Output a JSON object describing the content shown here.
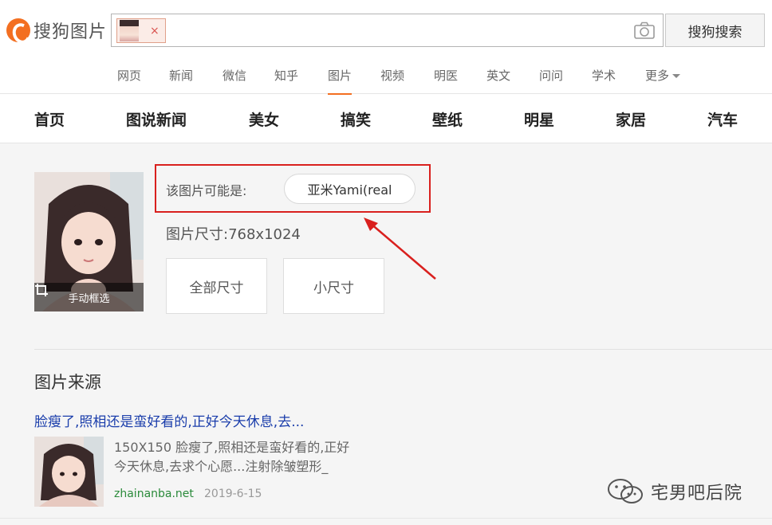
{
  "header": {
    "logo_text": "搜狗图片",
    "search_chip_close": "×",
    "search_button": "搜狗搜索"
  },
  "nav": {
    "tabs": [
      "网页",
      "新闻",
      "微信",
      "知乎",
      "图片",
      "视频",
      "明医",
      "英文",
      "问问",
      "学术",
      "更多"
    ],
    "active": "图片"
  },
  "categories": [
    "首页",
    "图说新闻",
    "美女",
    "搞笑",
    "壁纸",
    "明星",
    "家居",
    "汽车"
  ],
  "result": {
    "crop_label": "手动框选",
    "guess_label": "该图片可能是:",
    "guess_value": "亚米Yami(real",
    "size_label": "图片尺寸:768x1024",
    "btn_all_sizes": "全部尺寸",
    "btn_small": "小尺寸"
  },
  "source": {
    "heading": "图片来源",
    "link": "脸瘦了,照相还是蛮好看的,正好今天休息,去...",
    "desc": "150X150 脸瘦了,照相还是蛮好看的,正好今天休息,去求个心愿...注射除皱塑形_",
    "host": "zhainanba.net",
    "date": "2019-6-15"
  },
  "watermark": {
    "text": "宅男吧后院"
  },
  "colors": {
    "brand_orange": "#f36f21",
    "highlight_red": "#d9201e",
    "link_blue": "#1a3dab",
    "host_green": "#2a8a3a"
  }
}
